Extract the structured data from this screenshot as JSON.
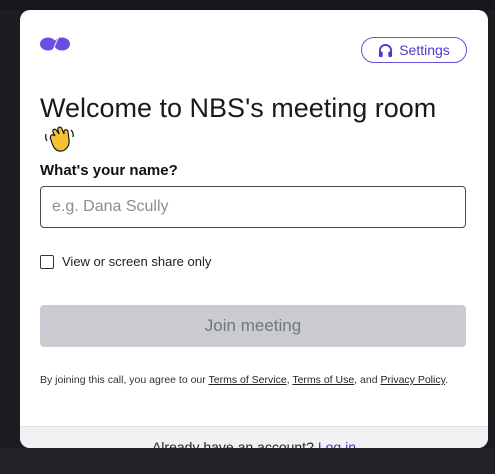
{
  "header": {
    "logo_icon": "daily-logo-icon",
    "settings_label": "Settings",
    "settings_icon": "headphones-icon"
  },
  "main": {
    "title": "Welcome to NBS's meeting room",
    "title_icon": "waving-hand-icon",
    "name_label": "What's your name?",
    "name_placeholder": "e.g. Dana Scully",
    "name_value": "",
    "view_only_label": "View or screen share only",
    "view_only_checked": false,
    "join_label": "Join meeting"
  },
  "terms": {
    "prefix": "By joining this call, you agree to our",
    "tos": "Terms of Service",
    "sep": ",",
    "tou": "Terms of Use",
    "and": ", and",
    "privacy": "Privacy Policy",
    "suffix": "."
  },
  "footer": {
    "prompt": "Already have an account?",
    "login": "Log in"
  },
  "colors": {
    "accent": "#4a3ad0",
    "join_disabled_bg": "#c9cbd1",
    "footer_bg": "#f1f1f3"
  }
}
